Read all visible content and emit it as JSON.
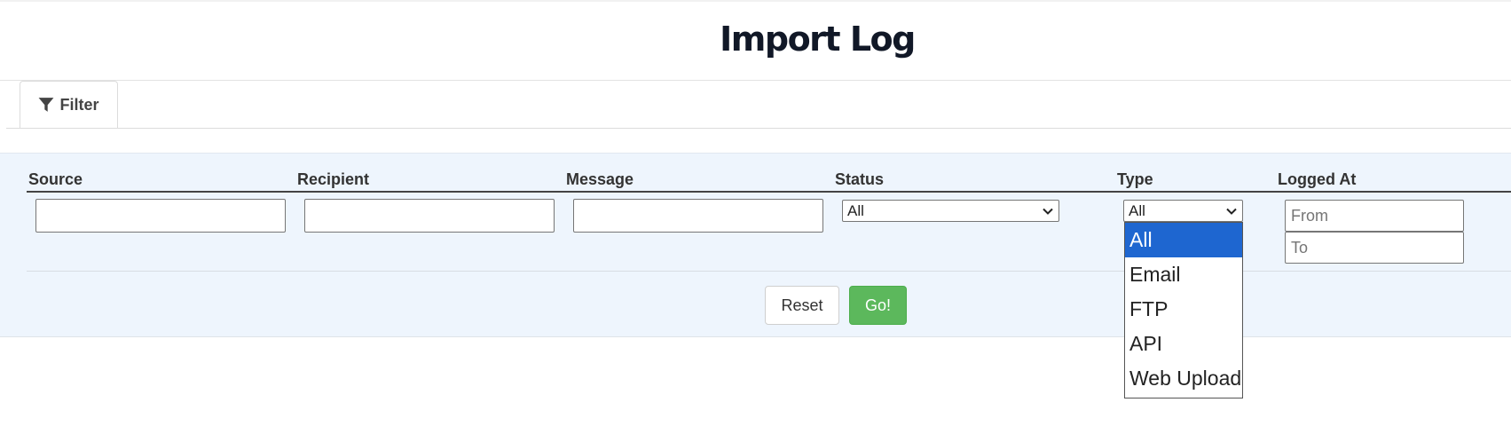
{
  "page": {
    "title": "Import Log"
  },
  "tabs": [
    {
      "label": "Filter",
      "icon": "filter-icon",
      "active": true
    }
  ],
  "filters": {
    "columns": {
      "source": "Source",
      "recipient": "Recipient",
      "message": "Message",
      "status": "Status",
      "type": "Type",
      "logged_at": "Logged At"
    },
    "status_select": {
      "value": "All"
    },
    "type_select": {
      "value": "All",
      "options": [
        "All",
        "Email",
        "FTP",
        "API",
        "Web Upload"
      ],
      "highlighted": "All"
    },
    "logged_at": {
      "from_placeholder": "From",
      "to_placeholder": "To"
    }
  },
  "buttons": {
    "reset": "Reset",
    "go": "Go!"
  },
  "colors": {
    "go_button": "#5cb85c",
    "selected_option": "#1e66d0",
    "panel_bg": "#eef5fd"
  }
}
